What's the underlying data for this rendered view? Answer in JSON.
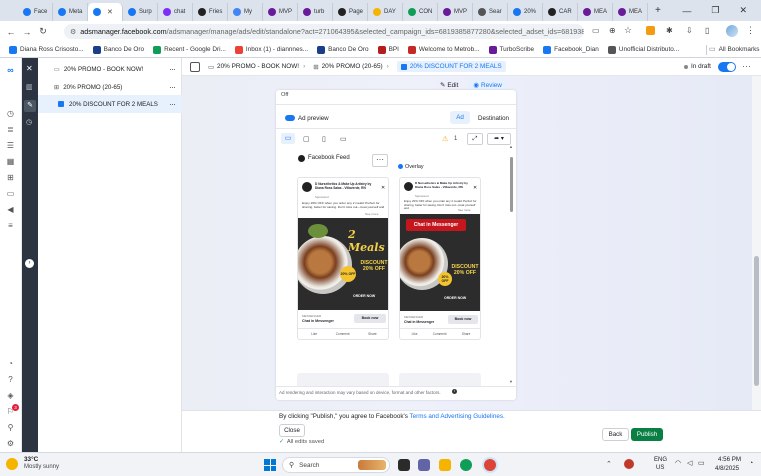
{
  "browser": {
    "tabs": [
      {
        "label": "Face",
        "icon": "facebook-icon",
        "color": "#1877f2"
      },
      {
        "label": "Meta",
        "icon": "meta-icon",
        "color": "#1877f2"
      },
      {
        "label": "",
        "icon": "meta-icon",
        "color": "#1877f2",
        "active": true
      },
      {
        "label": "Surp",
        "icon": "facebook-icon",
        "color": "#1877f2"
      },
      {
        "label": "chat",
        "icon": "messenger-icon",
        "color": "#7b2ff7"
      },
      {
        "label": "Fries",
        "icon": "chatgpt-icon",
        "color": "#222"
      },
      {
        "label": "My",
        "icon": "doc-icon",
        "color": "#4285f4"
      },
      {
        "label": "MVP",
        "icon": "brand-icon",
        "color": "#6a1b9a"
      },
      {
        "label": "turb",
        "icon": "turbo-icon",
        "color": "#6a1b9a"
      },
      {
        "label": "Page",
        "icon": "chatgpt-icon",
        "color": "#222"
      },
      {
        "label": "DAY",
        "icon": "folder-icon",
        "color": "#f4b400"
      },
      {
        "label": "CON",
        "icon": "sheets-icon",
        "color": "#0f9d58"
      },
      {
        "label": "MVP",
        "icon": "brand-icon",
        "color": "#6a1b9a"
      },
      {
        "label": "Sear",
        "icon": "search-icon",
        "color": "#555"
      },
      {
        "label": "20%",
        "icon": "facebook-icon",
        "color": "#1877f2"
      },
      {
        "label": "CAR",
        "icon": "chatgpt-icon",
        "color": "#222"
      },
      {
        "label": "MEA",
        "icon": "brand-icon",
        "color": "#6a1b9a"
      },
      {
        "label": "MEA",
        "icon": "brand-icon",
        "color": "#6a1b9a"
      }
    ],
    "url_host": "adsmanager.facebook.com",
    "url_path": "/adsmanager/manage/ads/edit/standalone?act=271064395&selected_campaign_ids=6819385877280&selected_adset_ids=6819385878..."
  },
  "bookmarks": [
    {
      "label": "Diana Ross Crisosto...",
      "color": "#1877f2"
    },
    {
      "label": "Banco De Oro",
      "color": "#1a3e8c"
    },
    {
      "label": "Recent - Google Dri...",
      "color": "#0f9d58"
    },
    {
      "label": "Inbox (1) - diannnes...",
      "color": "#ea4335"
    },
    {
      "label": "Banco De Oro",
      "color": "#1a3e8c"
    },
    {
      "label": "BPI",
      "color": "#b71c1c"
    },
    {
      "label": "Welcome to Metrob...",
      "color": "#c62828"
    },
    {
      "label": "TurboScribe",
      "color": "#6a1b9a"
    },
    {
      "label": "Facebook_Dian",
      "color": "#1877f2"
    },
    {
      "label": "Unofficial Distributo...",
      "color": "#555"
    }
  ],
  "all_bookmarks": "All Bookmarks",
  "tree": {
    "campaign": "20% PROMO - BOOK NOW!",
    "adset": "20% PROMO (20-65)",
    "ad": "20% DISCOUNT FOR 2 MEALS"
  },
  "toolbar": {
    "crumb_campaign": "20% PROMO - BOOK NOW!",
    "crumb_adset": "20% PROMO (20-65)",
    "crumb_ad": "20% DISCOUNT FOR 2 MEALS",
    "status": "In draft",
    "edit": "Edit",
    "review": "Review"
  },
  "preview": {
    "top_text": "Off",
    "ad_preview_label": "Ad preview",
    "tab_ad": "Ad",
    "tab_destination": "Destination",
    "warning_count": "1",
    "placement_label": "Facebook Feed",
    "overlay_label": "Overlay",
    "page_name": "D Nurseihetics & Make Up Artistry by Diana Ross Salas - Villaverde, RN",
    "sponsored": "Sponsored",
    "body": "Enjoy 20% OFF when you order any 2 meals! Perfect for sharing, better for saving. Don't miss out—treat yourself and",
    "see_more": "See more",
    "img_title": "2 Meals",
    "chat_banner": "Chat in Messenger",
    "discount": "DISCOUNT 20% OFF",
    "order_now": "ORDER NOW",
    "cta_source": "MESSENGER",
    "cta_title": "Chat in Messenger",
    "cta_button": "Book now",
    "actions": [
      "Like",
      "Comment",
      "Share"
    ],
    "disclaimer": "Ad rendering and interaction may vary based on device, format and other factors."
  },
  "footer": {
    "notice_prefix": "By clicking \"Publish,\" you agree to Facebook's ",
    "notice_link": "Terms and Advertising Guidelines.",
    "close": "Close",
    "saved": "All edits saved",
    "back": "Back",
    "publish": "Publish"
  },
  "taskbar": {
    "temp": "33°C",
    "weather": "Mostly sunny",
    "search": "Search",
    "lang1": "ENG",
    "lang2": "US",
    "time": "4:56 PM",
    "date": "4/8/2025"
  },
  "colors": {
    "accent": "#1877f2",
    "publish": "#0a7f44",
    "dark_rail": "#2b3440"
  }
}
